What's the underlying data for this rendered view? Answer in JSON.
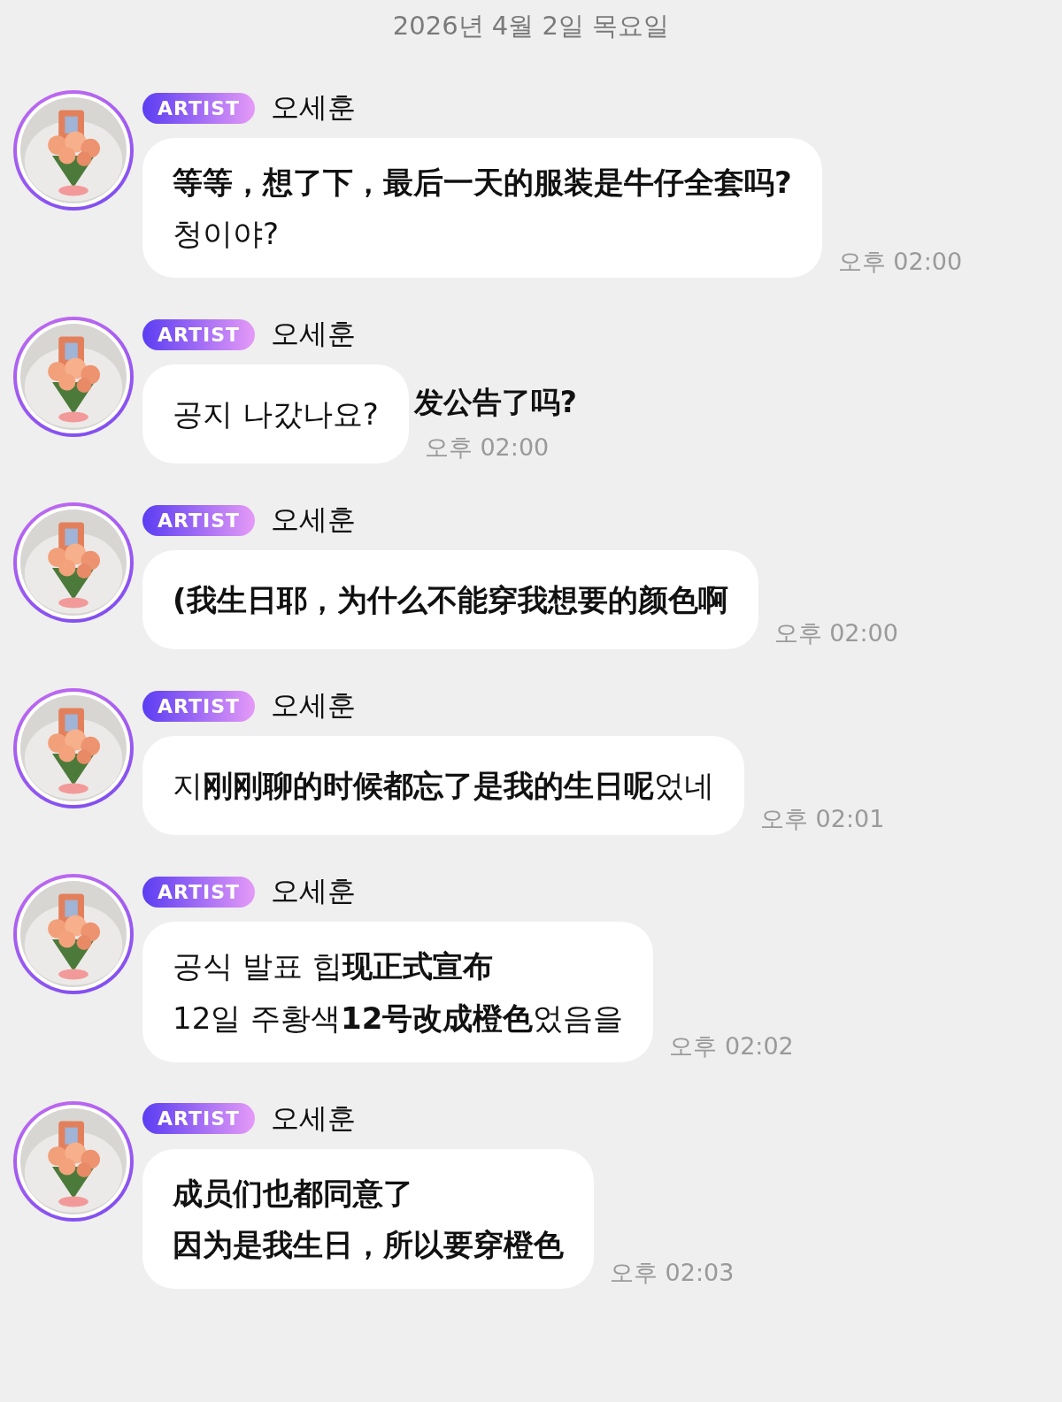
{
  "date_header": "2026년 4월 2일 목요일",
  "messages": [
    {
      "badge": "ARTIST",
      "sender": "오세훈",
      "lines": [
        [
          {
            "text": "等等，想了下，最后一天的服装是牛仔全套吗?",
            "kind": "zh"
          }
        ],
        [
          {
            "text": "청이야?",
            "kind": "ko"
          }
        ]
      ],
      "time": "오후 02:00"
    },
    {
      "badge": "ARTIST",
      "sender": "오세훈",
      "lines": [
        [
          {
            "text": "공지 나갔나요?",
            "kind": "ko"
          }
        ]
      ],
      "aside": "发公告了吗?",
      "time": "오후 02:00"
    },
    {
      "badge": "ARTIST",
      "sender": "오세훈",
      "lines": [
        [
          {
            "text": "(我生日耶，为什么不能穿我想要的颜色啊",
            "kind": "zh"
          }
        ]
      ],
      "time": "오후 02:00"
    },
    {
      "badge": "ARTIST",
      "sender": "오세훈",
      "lines": [
        [
          {
            "text": "지",
            "kind": "ko"
          },
          {
            "text": "刚刚聊的时候都忘了是我的生日呢",
            "kind": "zh"
          },
          {
            "text": "었네",
            "kind": "ko"
          }
        ]
      ],
      "time": "오후 02:01"
    },
    {
      "badge": "ARTIST",
      "sender": "오세훈",
      "lines": [
        [
          {
            "text": "공식 발표 힙",
            "kind": "ko"
          },
          {
            "text": "现正式宣布",
            "kind": "zh"
          }
        ],
        [
          {
            "text": "12일 주황색",
            "kind": "ko"
          },
          {
            "text": "12号改成橙色",
            "kind": "zh"
          },
          {
            "text": "었음을",
            "kind": "ko"
          }
        ]
      ],
      "time": "오후 02:02"
    },
    {
      "badge": "ARTIST",
      "sender": "오세훈",
      "lines": [
        [
          {
            "text": "成员们也都同意了",
            "kind": "zh"
          }
        ],
        [
          {
            "text": "因为是我生日，所以要穿橙色",
            "kind": "zh"
          }
        ]
      ],
      "time": "오후 02:03"
    }
  ]
}
